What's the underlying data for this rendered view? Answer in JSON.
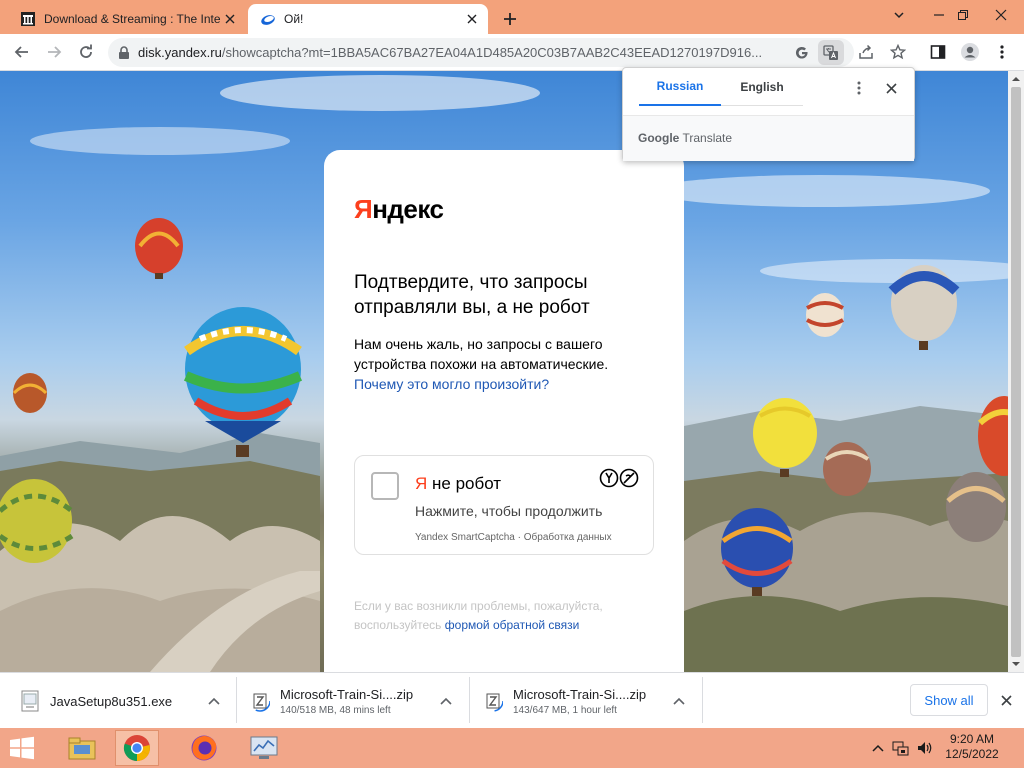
{
  "browser": {
    "tabs": [
      {
        "title": "Download & Streaming : The Inte",
        "active": false
      },
      {
        "title": "Ой!",
        "active": true
      }
    ],
    "address": {
      "host": "disk.yandex.ru",
      "path": "/showcaptcha?mt=1BBA5AC67BA27EA04A1D485A20C03B7AAB2C43EEAD1270197D916..."
    }
  },
  "translate_popup": {
    "languages": [
      "Russian",
      "English"
    ],
    "selected": "Russian",
    "brand_google": "Google",
    "brand_translate": "Translate"
  },
  "captcha_page": {
    "brand_first": "Я",
    "brand_rest": "ндекс",
    "headline": "Подтвердите, что запросы отправляли вы, а не робот",
    "description": "Нам очень жаль, но запросы с вашего устройства похожи на автоматические.",
    "why_link": "Почему это могло произойти?",
    "checkbox_label_first": "Я",
    "checkbox_label_rest": " не робот",
    "checkbox_hint": "Нажмите, чтобы продолжить",
    "smartcaptcha_link": "Yandex SmartCaptcha",
    "separator": "·",
    "data_processing_link": "Обработка данных",
    "problems_text": "Если у вас возникли проблемы, пожалуйста, воспользуйтесь",
    "feedback_link": "формой обратной связи"
  },
  "downloads": {
    "items": [
      {
        "name": "JavaSetup8u351.exe",
        "status": ""
      },
      {
        "name": "Microsoft-Train-Si....zip",
        "status": "140/518 MB, 48 mins left"
      },
      {
        "name": "Microsoft-Train-Si....zip",
        "status": "143/647 MB, 1 hour left"
      }
    ],
    "show_all": "Show all"
  },
  "taskbar": {
    "time": "9:20 AM",
    "date": "12/5/2022"
  },
  "colors": {
    "yandex_red": "#fc3f1d",
    "link_blue": "#1f58b4",
    "chrome_blue": "#1a73e8",
    "tabstrip": "#f3a27b",
    "taskbar": "#f2a689"
  }
}
